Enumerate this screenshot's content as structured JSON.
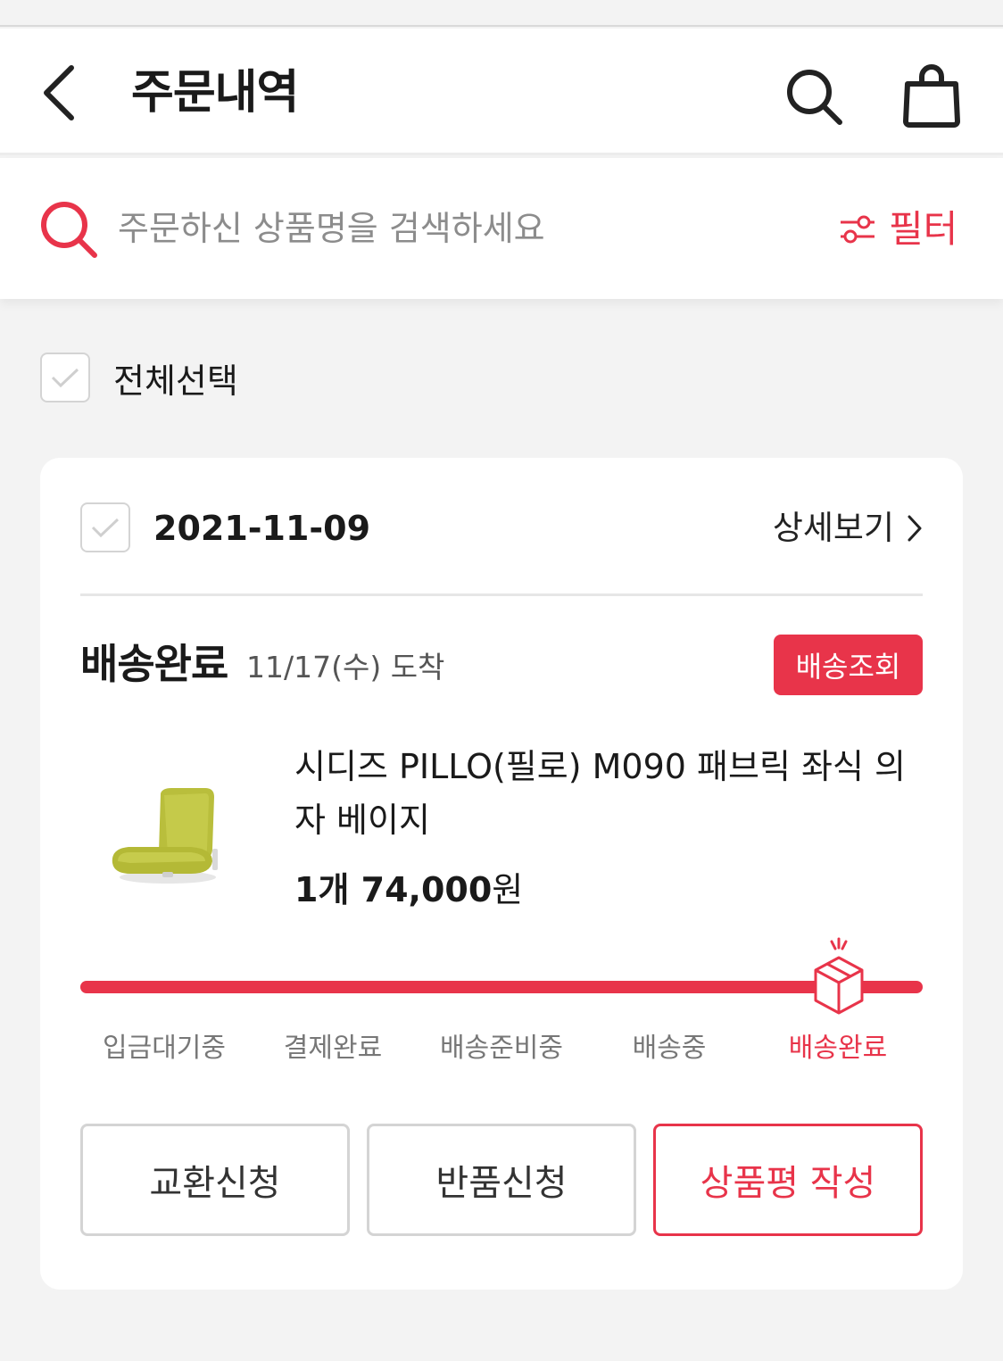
{
  "header": {
    "title": "주문내역"
  },
  "search": {
    "placeholder": "주문하신 상품명을 검색하세요",
    "filter_label": "필터"
  },
  "select_all": {
    "label": "전체선택"
  },
  "order": {
    "date": "2021-11-09",
    "detail_label": "상세보기",
    "status": "배송완료",
    "arrival": "11/17(수) 도착",
    "track_label": "배송조회",
    "product": {
      "name": "시디즈 PILLO(필로) M090 패브릭 좌식 의자 베이지",
      "quantity": "1개",
      "price": "74,000",
      "currency": "원"
    },
    "progress": {
      "steps": [
        "입금대기중",
        "결제완료",
        "배송준비중",
        "배송중",
        "배송완료"
      ],
      "current_step": 4
    },
    "actions": {
      "exchange": "교환신청",
      "return": "반품신청",
      "review": "상품평 작성"
    }
  },
  "colors": {
    "accent": "#e8344a",
    "background": "#f3f3f3",
    "card": "#ffffff"
  }
}
